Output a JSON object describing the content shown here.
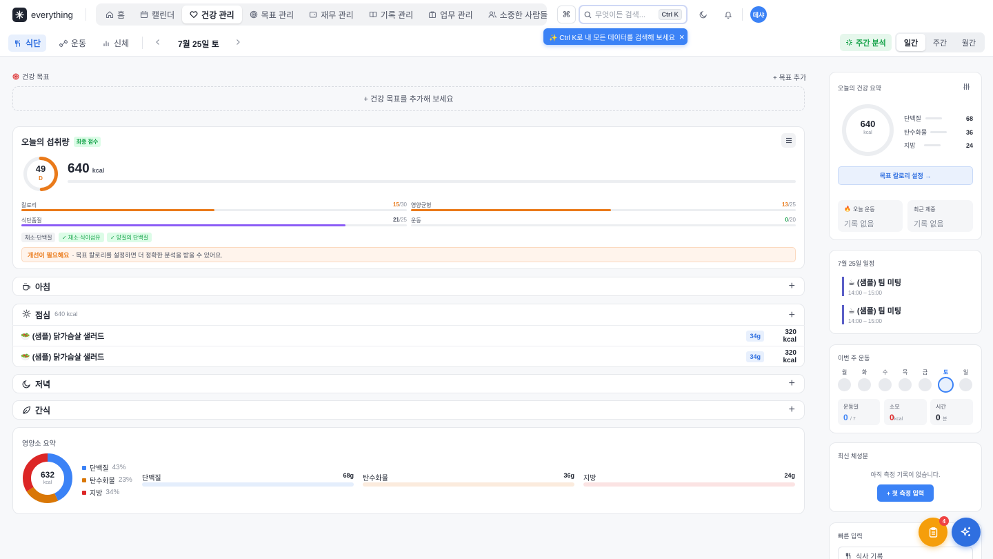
{
  "app": {
    "name": "everything"
  },
  "nav": {
    "tabs": [
      {
        "label": "홈",
        "icon": "home-icon"
      },
      {
        "label": "캘린더",
        "icon": "calendar-icon"
      },
      {
        "label": "건강 관리",
        "icon": "heart-icon",
        "active": true
      },
      {
        "label": "목표 관리",
        "icon": "target-icon"
      },
      {
        "label": "재무 관리",
        "icon": "wallet-icon"
      },
      {
        "label": "기록 관리",
        "icon": "book-icon"
      },
      {
        "label": "업무 관리",
        "icon": "briefcase-icon"
      },
      {
        "label": "소중한 사람들",
        "icon": "people-icon"
      }
    ]
  },
  "search": {
    "cmd_symbol": "⌘",
    "placeholder": "무엇이든 검색...",
    "shortcut": "Ctrl K"
  },
  "user": {
    "avatar_text": "데샤"
  },
  "tooltip": {
    "text": "✨ Ctrl K로 내 모든 데이터를 검색해 보세요",
    "close": "×"
  },
  "subnav": {
    "tabs": [
      {
        "label": "식단"
      },
      {
        "label": "운동"
      },
      {
        "label": "신체"
      }
    ],
    "date": "7월 25일 토",
    "weekly_btn": "주간 분석",
    "periods": [
      "일간",
      "주간",
      "월간"
    ]
  },
  "goals": {
    "title": "건강 목표",
    "add_link": "+ 목표 추가",
    "empty": "+ 건강 목표를 추가해 보세요"
  },
  "intake": {
    "title": "오늘의 섭취량",
    "badge": "최종 점수",
    "score": "49",
    "grade": "D",
    "score_value": 49,
    "kcal": "640",
    "kcal_unit": "kcal",
    "metrics": [
      {
        "label": "칼로리",
        "value": "15",
        "max": "/30",
        "color": "#ea7a1a",
        "fill": 0.5
      },
      {
        "label": "영양균형",
        "value": "13",
        "max": "/25",
        "color": "#ea7a1a",
        "fill": 0.52
      },
      {
        "label": "식단품질",
        "value": "21",
        "max": "/25",
        "color": "#8b5cf6",
        "fill": 0.84
      },
      {
        "label": "운동",
        "value": "0",
        "max": "/20",
        "color": "#16a34a",
        "fill": 0
      }
    ],
    "chips": [
      "채소·단백질",
      "채소·식이섬유",
      "양질의 단백질"
    ],
    "notice_strong": "개선이 필요해요",
    "notice_text": "· 목표 칼로리를 설정하면 더 정확한 분석을 받을 수 있어요."
  },
  "meals": {
    "breakfast": {
      "name": "아침",
      "icon": "coffee-cup-icon"
    },
    "lunch": {
      "name": "점심",
      "icon": "sun-icon",
      "kcal": "640 kcal",
      "items": [
        {
          "name": "🥗 (샘플) 닭가슴살 샐러드",
          "gram": "34g",
          "kcal": "320 kcal"
        },
        {
          "name": "🥗 (샘플) 닭가슴살 샐러드",
          "gram": "34g",
          "kcal": "320 kcal"
        }
      ]
    },
    "dinner": {
      "name": "저녁",
      "icon": "moon-icon"
    },
    "snack": {
      "name": "간식",
      "icon": "leaf-icon"
    },
    "add": "+"
  },
  "nutrients": {
    "title": "영양소 요약",
    "total": "632",
    "unit": "kcal",
    "items": [
      {
        "name": "단백질",
        "pct": "43%",
        "value": "68g",
        "color": "#3b82f6",
        "track": "#e4eefc",
        "share": 0.43
      },
      {
        "name": "탄수화물",
        "pct": "23%",
        "value": "36g",
        "color": "#d97706",
        "track": "#fbebdd",
        "share": 0.23
      },
      {
        "name": "지방",
        "pct": "34%",
        "value": "24g",
        "color": "#dc2626",
        "track": "#fbe3e3",
        "share": 0.34
      }
    ]
  },
  "summary": {
    "title": "오늘의 건강 요약",
    "kcal": "640",
    "unit": "kcal",
    "macros": [
      {
        "name": "단백질",
        "value": "68"
      },
      {
        "name": "탄수화물",
        "value": "36"
      },
      {
        "name": "지방",
        "value": "24"
      }
    ],
    "goal_btn": "목표 칼로리 설정 →",
    "today_ex_label": "오늘 운동",
    "today_ex_value": "기록 없음",
    "weight_label": "최근 체중",
    "weight_value": "기록 없음"
  },
  "schedule": {
    "title": "7월 25일 일정",
    "events": [
      {
        "title": "☕ (샘플) 팀 미팅",
        "time": "14:00 – 15:00"
      },
      {
        "title": "☕ (샘플) 팀 미팅",
        "time": "14:00 – 15:00"
      }
    ]
  },
  "week": {
    "title": "이번 주 운동",
    "days": [
      "월",
      "화",
      "수",
      "목",
      "금",
      "토",
      "일"
    ],
    "today_index": 5,
    "stats": [
      {
        "label": "운동일",
        "value": "0",
        "unit": "/ 7",
        "color": "#3b82f6"
      },
      {
        "label": "소모",
        "value": "0",
        "unit": "kcal",
        "color": "#dc2626"
      },
      {
        "label": "시간",
        "value": "0",
        "unit": "분",
        "color": "#1f2430"
      }
    ]
  },
  "body": {
    "title": "최신 체성분",
    "empty": "아직 측정 기록이 없습니다.",
    "button": "+ 첫 측정 입력"
  },
  "quick": {
    "title": "빠른 입력",
    "item": "식사 기록"
  },
  "fab": {
    "badge": "4"
  },
  "colors": {
    "accent": "#3b82f6",
    "orange": "#ea7a1a",
    "green": "#16a34a"
  }
}
